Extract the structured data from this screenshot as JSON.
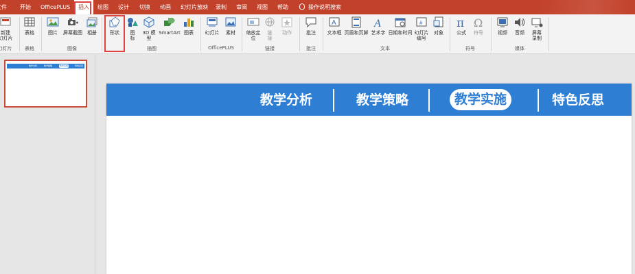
{
  "menu": {
    "tabs": [
      "文件",
      "开始",
      "OfficePLUS",
      "插入",
      "绘图",
      "设计",
      "切换",
      "动画",
      "幻灯片放映",
      "录制",
      "审阅",
      "视图",
      "帮助"
    ],
    "active_tab": "插入",
    "tell_me": "操作说明搜索"
  },
  "ribbon": {
    "buttons": {
      "new_slide": "新建\n幻灯片",
      "table": "表格",
      "picture": "图片",
      "screenshot": "屏幕截图",
      "album": "相册",
      "shapes": "形状",
      "icons": "图\n标",
      "model3d": "3D 模\n型",
      "smartart": "SmartArt",
      "chart": "图表",
      "slide_lib": "幻灯片",
      "material": "素材",
      "zoom": "缩放定\n位",
      "link": "链\n接",
      "action": "动作",
      "comment": "批注",
      "textbox": "文本框",
      "header_footer": "页眉和页脚",
      "wordart": "艺术字",
      "datetime": "日期和时间",
      "slide_number": "幻灯片\n编号",
      "object": "对象",
      "equation": "公式",
      "symbol": "符号",
      "video": "视频",
      "audio": "音频",
      "screen_record": "屏幕\n录制"
    },
    "groups": {
      "slides": "幻灯片",
      "tables": "表格",
      "images": "图像",
      "illustrations": "插图",
      "officeplus": "OfficePLUS",
      "links": "链接",
      "comments": "批注",
      "text": "文本",
      "symbols": "符号",
      "media": "媒体"
    }
  },
  "slide": {
    "nav": [
      "教学分析",
      "教学策略",
      "教学实施",
      "特色反思"
    ],
    "active_nav": "教学实施",
    "colors": {
      "bar": "#2e7ed3",
      "menu": "#c2412a",
      "highlight": "#e04040"
    }
  }
}
